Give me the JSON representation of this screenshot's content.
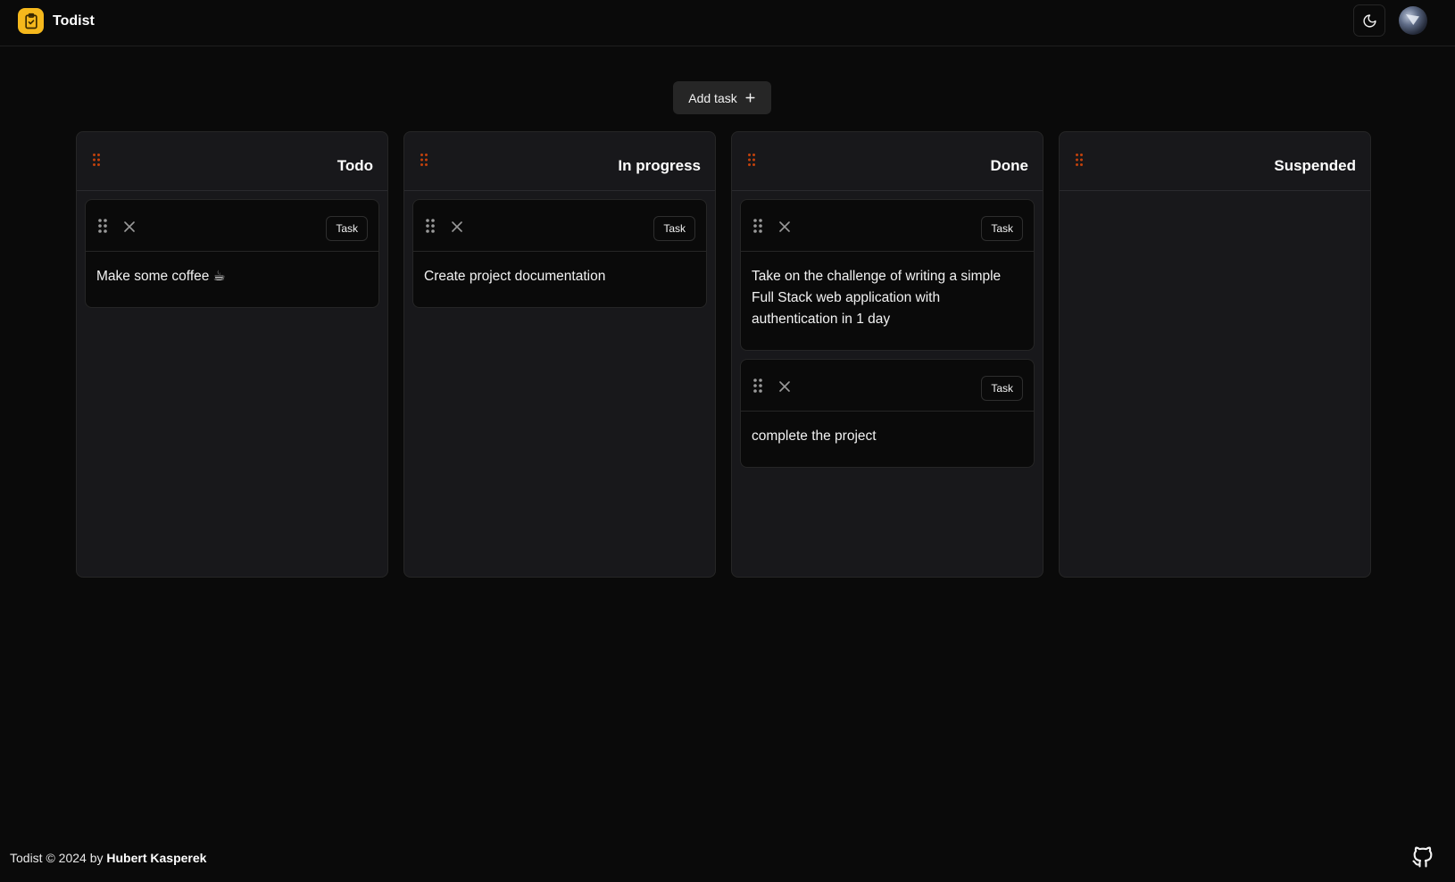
{
  "app": {
    "name": "Todist"
  },
  "header": {
    "theme_toggle_icon": "moon-icon",
    "avatar_icon": "user-avatar"
  },
  "toolbar": {
    "add_task_label": "Add task",
    "add_task_icon": "plus-icon"
  },
  "columns": [
    {
      "title": "Todo",
      "cards": [
        {
          "badge": "Task",
          "text": "Make some coffee ☕"
        }
      ]
    },
    {
      "title": "In progress",
      "cards": [
        {
          "badge": "Task",
          "text": "Create project documentation"
        }
      ]
    },
    {
      "title": "Done",
      "cards": [
        {
          "badge": "Task",
          "text": "Take on the challenge of writing a simple Full Stack web application with authentication in 1 day"
        },
        {
          "badge": "Task",
          "text": "complete the project"
        }
      ]
    },
    {
      "title": "Suspended",
      "cards": []
    }
  ],
  "footer": {
    "prefix": "Todist © 2024 by",
    "author": "Hubert Kasperek",
    "github_icon": "github-icon"
  },
  "colors": {
    "background": "#0a0a0a",
    "column_bg": "#18181b",
    "accent_logo": "#f5b81c",
    "grip_column": "#c2410c"
  }
}
